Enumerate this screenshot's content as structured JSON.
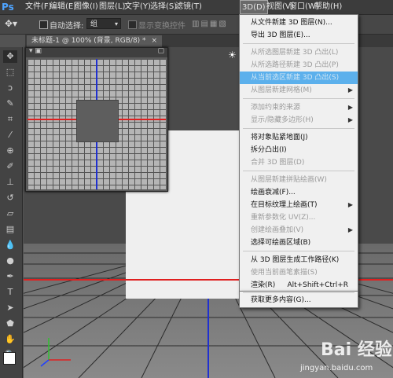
{
  "app": {
    "logo": "Ps"
  },
  "menubar": {
    "items": [
      "文件(F)",
      "编辑(E)",
      "图像(I)",
      "图层(L)",
      "文字(Y)",
      "选择(S)",
      "滤镜(T)",
      "3D(D)",
      "视图(V)",
      "窗口(W)",
      "帮助(H)"
    ],
    "open_item": "3D(D)"
  },
  "options_bar": {
    "auto_select_label": "自动选择:",
    "auto_select_value": "组",
    "transform_label": "显示变换控件"
  },
  "document": {
    "tab_title": "未标题-1 @ 100% (背景, RGB/8) *",
    "close": "×"
  },
  "tools": [
    "move-tool",
    "marquee-tool",
    "lasso-tool",
    "quick-select-tool",
    "crop-tool",
    "eyedropper-tool",
    "healing-tool",
    "brush-tool",
    "stamp-tool",
    "history-brush-tool",
    "eraser-tool",
    "gradient-tool",
    "blur-tool",
    "dodge-tool",
    "pen-tool",
    "type-tool",
    "path-select-tool",
    "shape-tool",
    "hand-tool",
    "zoom-tool"
  ],
  "dropdown": {
    "items": [
      {
        "label": "从文件新建 3D 图层(N)...",
        "state": "normal"
      },
      {
        "label": "导出 3D 图层(E)...",
        "state": "normal"
      },
      {
        "label": "从所选图层新建 3D 凸出(L)",
        "state": "disabled"
      },
      {
        "label": "从所选路径新建 3D 凸出(P)",
        "state": "disabled"
      },
      {
        "label": "从当前选区新建 3D 凸出(S)",
        "state": "highlighted"
      },
      {
        "label": "从图层新建网格(M)",
        "state": "disabled",
        "submenu": true
      },
      {
        "label": "添加约束的来源",
        "state": "disabled",
        "submenu": true
      },
      {
        "label": "显示/隐藏多边形(H)",
        "state": "disabled",
        "submenu": true
      },
      {
        "label": "将对象贴紧地面(J)",
        "state": "normal"
      },
      {
        "label": "拆分凸出(I)",
        "state": "normal"
      },
      {
        "label": "合并 3D 图层(D)",
        "state": "disabled"
      },
      {
        "label": "从图层新建拼贴绘画(W)",
        "state": "disabled"
      },
      {
        "label": "绘画衰减(F)...",
        "state": "normal"
      },
      {
        "label": "在目标纹理上绘画(T)",
        "state": "normal",
        "submenu": true
      },
      {
        "label": "重新参数化 UV(Z)...",
        "state": "disabled"
      },
      {
        "label": "创建绘画叠加(V)",
        "state": "disabled",
        "submenu": true
      },
      {
        "label": "选择可绘画区域(B)",
        "state": "normal"
      },
      {
        "label": "从 3D 图层生成工作路径(K)",
        "state": "normal"
      },
      {
        "label": "使用当前画笔素描(S)",
        "state": "disabled"
      },
      {
        "label": "渲染(R)",
        "state": "normal",
        "shortcut": "Alt+Shift+Ctrl+R"
      },
      {
        "label": "获取更多内容(G)...",
        "state": "normal"
      }
    ]
  },
  "watermark": {
    "logo": "Bai 经验",
    "url": "jingyan.baidu.com"
  },
  "colors": {
    "highlight": "#5cb0ec",
    "axis_red": "#e02020",
    "axis_blue": "#2030d0"
  }
}
